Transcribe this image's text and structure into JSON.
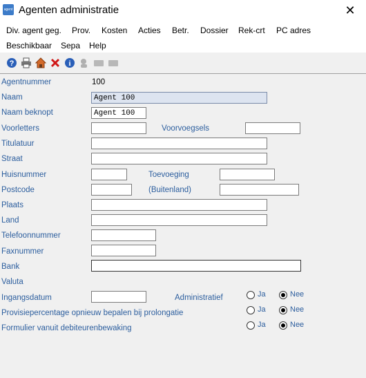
{
  "window": {
    "title": "Agenten administratie",
    "icon_text": "agent"
  },
  "menu": {
    "items": [
      "Div. agent geg.",
      "Prov.",
      "Kosten",
      "Acties",
      "Betr.",
      "Dossier",
      "Rek-crt",
      "PC adres",
      "Beschikbaar",
      "Sepa",
      "Help"
    ]
  },
  "toolbar": {
    "icons": [
      "help-icon",
      "print-icon",
      "home-icon",
      "delete-icon",
      "info-icon",
      "search-user-icon",
      "card-icon",
      "card2-icon"
    ]
  },
  "form": {
    "agentnummer": {
      "label": "Agentnummer",
      "value": "100"
    },
    "naam": {
      "label": "Naam",
      "value": "Agent 100"
    },
    "naam_beknopt": {
      "label": "Naam beknopt",
      "value": "Agent 100"
    },
    "voorletters": {
      "label": "Voorletters",
      "value": ""
    },
    "voorvoegsels": {
      "label": "Voorvoegsels",
      "value": ""
    },
    "titulatuur": {
      "label": "Titulatuur",
      "value": ""
    },
    "straat": {
      "label": "Straat",
      "value": ""
    },
    "huisnummer": {
      "label": "Huisnummer",
      "value": ""
    },
    "toevoeging": {
      "label": "Toevoeging",
      "value": ""
    },
    "postcode": {
      "label": "Postcode",
      "value": ""
    },
    "buitenland": {
      "label": "(Buitenland)",
      "value": ""
    },
    "plaats": {
      "label": "Plaats",
      "value": ""
    },
    "land": {
      "label": "Land",
      "value": ""
    },
    "telefoonnummer": {
      "label": "Telefoonnummer",
      "value": ""
    },
    "faxnummer": {
      "label": "Faxnummer",
      "value": ""
    },
    "bank": {
      "label": "Bank",
      "value": ""
    },
    "valuta": {
      "label": "Valuta"
    },
    "ingangsdatum": {
      "label": "Ingangsdatum",
      "value": ""
    },
    "administratief": {
      "label": "Administratief",
      "selected": "Nee"
    },
    "provisie": {
      "label": "Provisiepercentage opnieuw bepalen bij prolongatie",
      "selected": "Nee"
    },
    "formulier": {
      "label": "Formulier vanuit debiteurenbewaking",
      "selected": "Nee"
    },
    "ja": "Ja",
    "nee": "Nee"
  }
}
